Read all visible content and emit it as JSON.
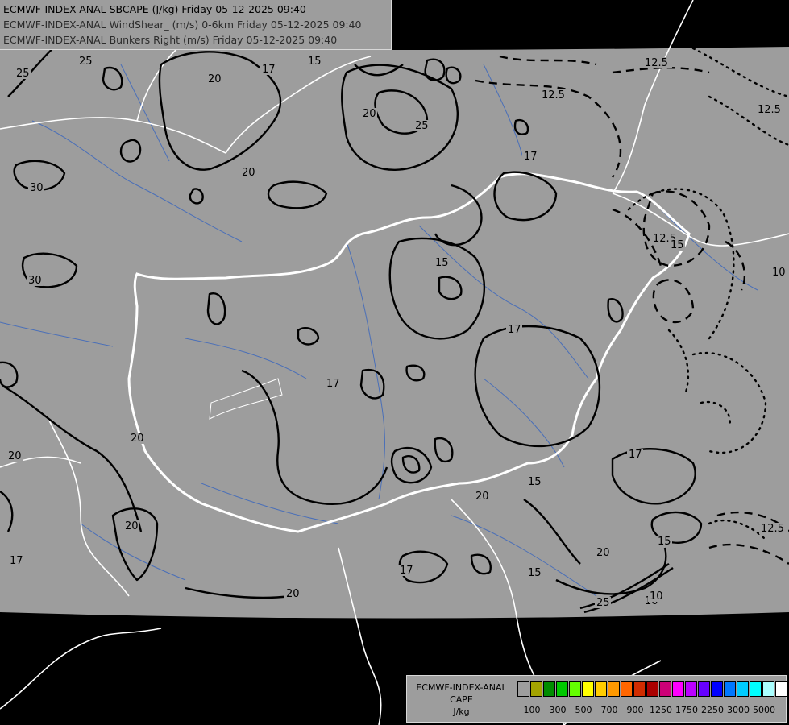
{
  "title": {
    "line1": "ECMWF-INDEX-ANAL SBCAPE (J/kg) Friday 05-12-2025 09:40",
    "line2": "ECMWF-INDEX-ANAL WindShear_ (m/s) 0-6km Friday 05-12-2025 09:40",
    "line3": "ECMWF-INDEX-ANAL Bunkers Right (m/s) Friday 05-12-2025 09:40"
  },
  "legend": {
    "title_line1": "ECMWF-INDEX-ANAL",
    "title_line2": "CAPE",
    "title_line3": "J/kg",
    "colors": [
      "#9d9d9d",
      "#a3a300",
      "#008c00",
      "#00c800",
      "#64ff00",
      "#ffff00",
      "#ffcc00",
      "#ff9900",
      "#ff6600",
      "#d02c00",
      "#aa0000",
      "#cc0077",
      "#ff00ff",
      "#bb00ff",
      "#6600ff",
      "#0000ff",
      "#0077ff",
      "#00ccff",
      "#00ffff",
      "#aaffff",
      "#ffffff"
    ],
    "ticks": [
      "100",
      "300",
      "500",
      "700",
      "900",
      "1250",
      "1750",
      "2250",
      "3000",
      "5000"
    ]
  },
  "contour_labels": [
    "25",
    "25",
    "20",
    "17",
    "15",
    "12.5",
    "12.5",
    "12.5",
    "20",
    "25",
    "30",
    "20",
    "17",
    "15",
    "12.5",
    "10",
    "30",
    "15",
    "17",
    "20",
    "17",
    "17",
    "20",
    "15",
    "17",
    "15",
    "12.5",
    "20",
    "20",
    "17",
    "20",
    "15",
    "25",
    "10",
    "10",
    "20"
  ],
  "colors": {
    "background_data": "#9d9d9d",
    "outside_domain": "#000000",
    "borders": "#ffffff",
    "rivers": "#4a6fb8",
    "contours": "#000000"
  }
}
